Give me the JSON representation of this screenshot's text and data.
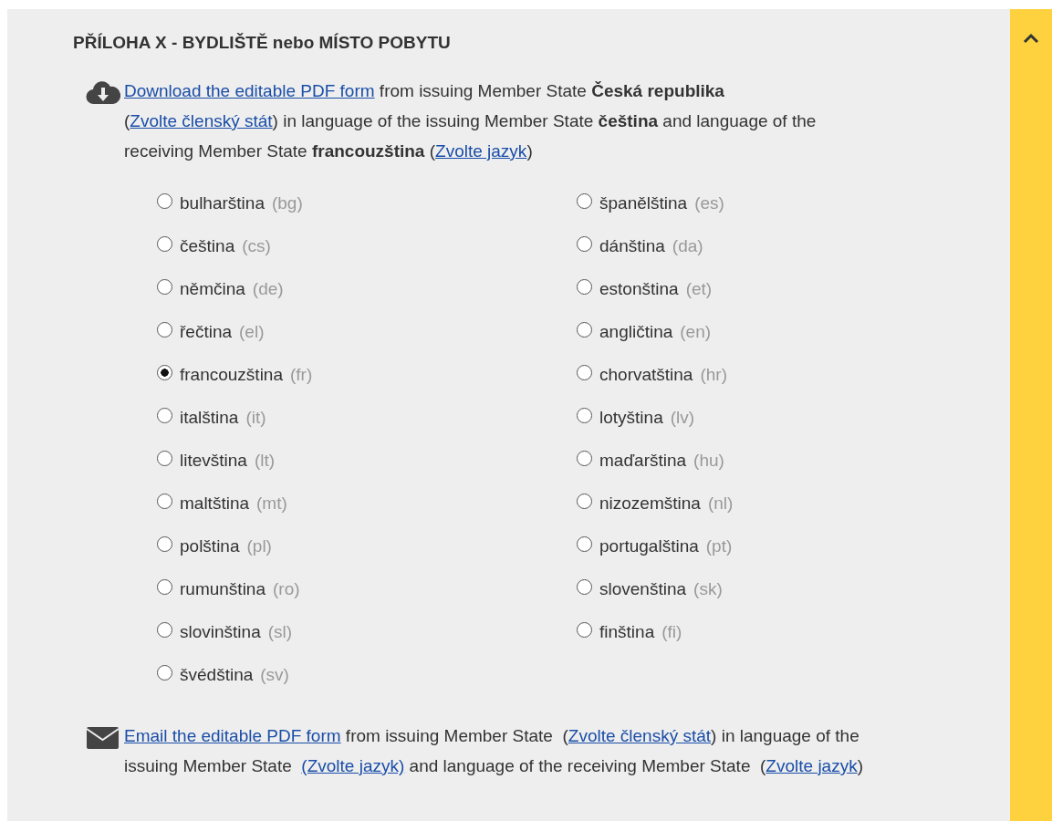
{
  "section": {
    "title": "PŘÍLOHA X - BYDLIŠTĚ nebo MÍSTO POBYTU",
    "expanded": true
  },
  "download": {
    "kind": "download",
    "segments": [
      {
        "kind": "link",
        "text": "Download the editable PDF form"
      },
      {
        "kind": "text",
        "text": " from issuing Member State "
      },
      {
        "kind": "bold",
        "text": "Česká republika"
      },
      {
        "kind": "text",
        "text": " ("
      },
      {
        "kind": "link",
        "text": "Zvolte členský stát"
      },
      {
        "kind": "text",
        "text": ") in language of the issuing Member State "
      },
      {
        "kind": "bold",
        "text": "čeština"
      },
      {
        "kind": "text",
        "text": " and language of the receiving Member State "
      },
      {
        "kind": "bold",
        "text": "francouzština"
      },
      {
        "kind": "text",
        "text": " ("
      },
      {
        "kind": "link",
        "text": "Zvolte jazyk"
      },
      {
        "kind": "text",
        "text": ")"
      }
    ]
  },
  "languages": [
    {
      "name": "bulharština",
      "code": "(bg)",
      "selected": false
    },
    {
      "name": "čeština",
      "code": "(cs)",
      "selected": false
    },
    {
      "name": "němčina",
      "code": "(de)",
      "selected": false
    },
    {
      "name": "řečtina",
      "code": "(el)",
      "selected": false
    },
    {
      "name": "francouzština",
      "code": "(fr)",
      "selected": true
    },
    {
      "name": "italština",
      "code": "(it)",
      "selected": false
    },
    {
      "name": "litevština",
      "code": "(lt)",
      "selected": false
    },
    {
      "name": "maltština",
      "code": "(mt)",
      "selected": false
    },
    {
      "name": "polština",
      "code": "(pl)",
      "selected": false
    },
    {
      "name": "rumunština",
      "code": "(ro)",
      "selected": false
    },
    {
      "name": "slovinština",
      "code": "(sl)",
      "selected": false
    },
    {
      "name": "švédština",
      "code": "(sv)",
      "selected": false
    },
    {
      "name": "španělština",
      "code": "(es)",
      "selected": false
    },
    {
      "name": "dánština",
      "code": "(da)",
      "selected": false
    },
    {
      "name": "estonština",
      "code": "(et)",
      "selected": false
    },
    {
      "name": "angličtina",
      "code": "(en)",
      "selected": false
    },
    {
      "name": "chorvatština",
      "code": "(hr)",
      "selected": false
    },
    {
      "name": "lotyština",
      "code": "(lv)",
      "selected": false
    },
    {
      "name": "maďarština",
      "code": "(hu)",
      "selected": false
    },
    {
      "name": "nizozemština",
      "code": "(nl)",
      "selected": false
    },
    {
      "name": "portugalština",
      "code": "(pt)",
      "selected": false
    },
    {
      "name": "slovenština",
      "code": "(sk)",
      "selected": false
    },
    {
      "name": "finština",
      "code": "(fi)",
      "selected": false
    }
  ],
  "email": {
    "kind": "email",
    "segments": [
      {
        "kind": "link",
        "text": "Email the editable PDF form"
      },
      {
        "kind": "text",
        "text": " from issuing Member State  ("
      },
      {
        "kind": "link",
        "text": "Zvolte členský stát"
      },
      {
        "kind": "text",
        "text": ") in language of the issuing Member State  "
      },
      {
        "kind": "link",
        "text": "(Zvolte jazyk)"
      },
      {
        "kind": "text",
        "text": " and language of the receiving Member State  ("
      },
      {
        "kind": "link",
        "text": "Zvolte jazyk"
      },
      {
        "kind": "text",
        "text": ")"
      }
    ]
  }
}
